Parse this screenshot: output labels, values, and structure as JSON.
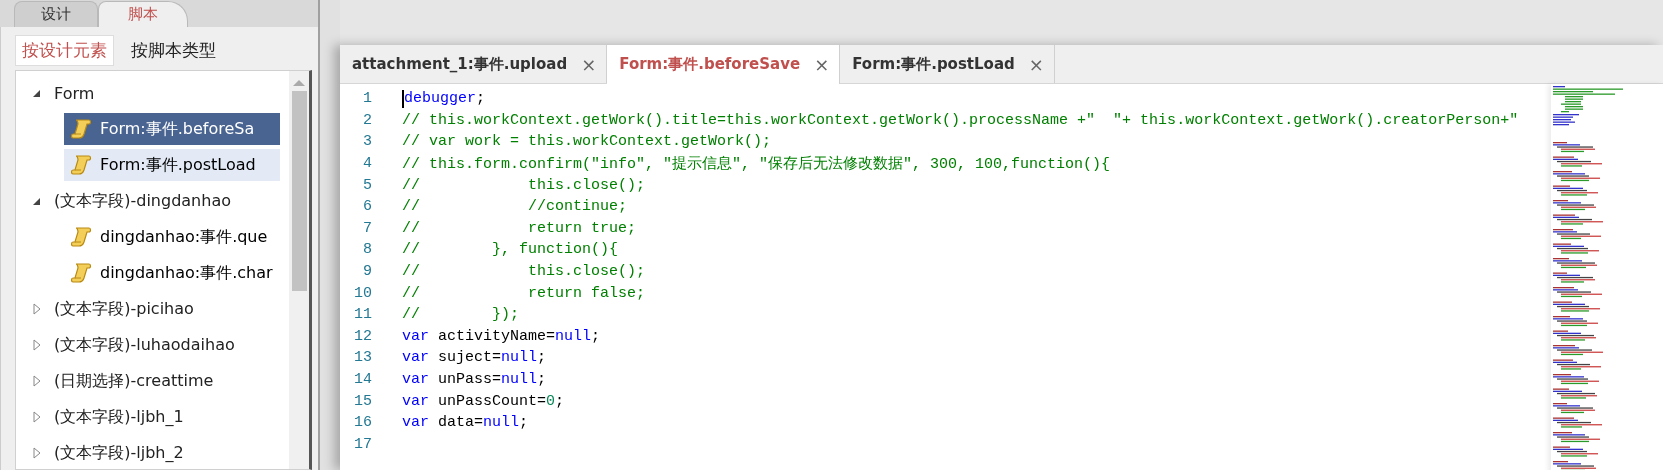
{
  "top_tabs": [
    {
      "label": "设计",
      "selected": false
    },
    {
      "label": "脚本",
      "selected": true
    }
  ],
  "view_tabs": [
    {
      "label": "按设计元素",
      "selected": true
    },
    {
      "label": "按脚本类型",
      "selected": false
    }
  ],
  "tree": [
    {
      "label": "Form",
      "expanded": true,
      "children": [
        {
          "label": "Form:事件.beforeSa",
          "selected": true,
          "highlighted": false
        },
        {
          "label": "Form:事件.postLoad",
          "selected": false,
          "highlighted": true
        }
      ]
    },
    {
      "label": "(文本字段)-dingdanhao",
      "expanded": true,
      "children": [
        {
          "label": "dingdanhao:事件.que",
          "selected": false,
          "highlighted": false
        },
        {
          "label": "dingdanhao:事件.char",
          "selected": false,
          "highlighted": false
        }
      ]
    },
    {
      "label": "(文本字段)-picihao",
      "expanded": false
    },
    {
      "label": "(文本字段)-luhaodaihao",
      "expanded": false
    },
    {
      "label": "(日期选择)-creattime",
      "expanded": false
    },
    {
      "label": "(文本字段)-ljbh_1",
      "expanded": false
    },
    {
      "label": "(文本字段)-ljbh_2",
      "expanded": false
    }
  ],
  "editor": {
    "tabs": [
      {
        "label": "attachment_1:事件.upload",
        "close": "×",
        "selected": false
      },
      {
        "label": "Form:事件.beforeSave",
        "close": "×",
        "selected": true
      },
      {
        "label": "Form:事件.postLoad",
        "close": "×",
        "selected": false
      }
    ],
    "lines": [
      {
        "number": "1",
        "tokens": [
          {
            "kind": "keyword",
            "text": "debugger"
          },
          {
            "kind": "plain",
            "text": ";"
          }
        ]
      },
      {
        "number": "2",
        "tokens": [
          {
            "kind": "comment",
            "text": "// this.workContext.getWork().title=this.workContext.getWork().processName +\"  \"+ this.workContext.getWork().creatorPerson+\""
          }
        ]
      },
      {
        "number": "3",
        "tokens": [
          {
            "kind": "comment",
            "text": "// var work = this.workContext.getWork();"
          }
        ]
      },
      {
        "number": "4",
        "tokens": [
          {
            "kind": "comment",
            "text": "// this.form.confirm(\"info\", \"提示信息\", \"保存后无法修改数据\", 300, 100,function(){"
          }
        ]
      },
      {
        "number": "5",
        "tokens": [
          {
            "kind": "comment",
            "text": "//            this.close();"
          }
        ]
      },
      {
        "number": "6",
        "tokens": [
          {
            "kind": "comment",
            "text": "//            //continue;"
          }
        ]
      },
      {
        "number": "7",
        "tokens": [
          {
            "kind": "comment",
            "text": "//            return true;"
          }
        ]
      },
      {
        "number": "8",
        "tokens": [
          {
            "kind": "comment",
            "text": "//        }, function(){"
          }
        ]
      },
      {
        "number": "9",
        "tokens": [
          {
            "kind": "comment",
            "text": "//            this.close();"
          }
        ]
      },
      {
        "number": "10",
        "tokens": [
          {
            "kind": "comment",
            "text": "//            return false;"
          }
        ]
      },
      {
        "number": "11",
        "tokens": [
          {
            "kind": "comment",
            "text": "//        });"
          }
        ]
      },
      {
        "number": "12",
        "tokens": [
          {
            "kind": "keyword",
            "text": "var"
          },
          {
            "kind": "plain",
            "text": " activityName="
          },
          {
            "kind": "keyword",
            "text": "null"
          },
          {
            "kind": "plain",
            "text": ";"
          }
        ]
      },
      {
        "number": "13",
        "tokens": [
          {
            "kind": "keyword",
            "text": "var"
          },
          {
            "kind": "plain",
            "text": " suject="
          },
          {
            "kind": "keyword",
            "text": "null"
          },
          {
            "kind": "plain",
            "text": ";"
          }
        ]
      },
      {
        "number": "14",
        "tokens": [
          {
            "kind": "keyword",
            "text": "var"
          },
          {
            "kind": "plain",
            "text": " unPass="
          },
          {
            "kind": "keyword",
            "text": "null"
          },
          {
            "kind": "plain",
            "text": ";"
          }
        ]
      },
      {
        "number": "15",
        "tokens": [
          {
            "kind": "keyword",
            "text": "var"
          },
          {
            "kind": "plain",
            "text": " unPassCount="
          },
          {
            "kind": "number",
            "text": "0"
          },
          {
            "kind": "plain",
            "text": ";"
          }
        ]
      },
      {
        "number": "16",
        "tokens": [
          {
            "kind": "keyword",
            "text": "var"
          },
          {
            "kind": "plain",
            "text": " data="
          },
          {
            "kind": "keyword",
            "text": "null"
          },
          {
            "kind": "plain",
            "text": ";"
          }
        ]
      },
      {
        "number": "17"
      }
    ]
  }
}
